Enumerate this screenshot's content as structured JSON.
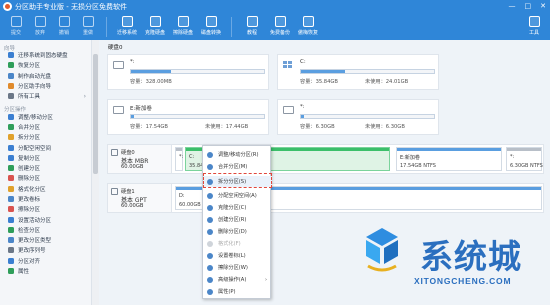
{
  "app": {
    "title": "分区助手专业版 - 无损分区免费软件",
    "window_controls": [
      "—",
      "□",
      "✕"
    ]
  },
  "toolbar": {
    "items": [
      {
        "label": "提交",
        "icon": "commit-icon"
      },
      {
        "label": "放弃",
        "icon": "discard-icon"
      },
      {
        "label": "撤销",
        "icon": "undo-icon"
      },
      {
        "label": "重做",
        "icon": "redo-icon"
      },
      {
        "label": "迁移系统",
        "icon": "migrate-icon"
      },
      {
        "label": "克隆硬盘",
        "icon": "clone-icon"
      },
      {
        "label": "擦除硬盘",
        "icon": "wipe-icon"
      },
      {
        "label": "磁盘转换",
        "icon": "convert-icon"
      },
      {
        "label": "教程",
        "icon": "tutorial-icon"
      },
      {
        "label": "免费备份",
        "icon": "backup-icon"
      },
      {
        "label": "傲梅恢复",
        "icon": "recovery-icon"
      },
      {
        "label": "工具",
        "icon": "tools-icon"
      }
    ]
  },
  "sidebar": {
    "section1": "向导",
    "wizard_items": [
      {
        "label": "迁移系统到固态硬盘",
        "color": "#3b7fd1"
      },
      {
        "label": "恢复分区",
        "color": "#2f9e5a"
      },
      {
        "label": "制作启动光盘",
        "color": "#4b86c8"
      },
      {
        "label": "分区助手向导",
        "color": "#e08a2c"
      },
      {
        "label": "所有工具",
        "color": "#6b7787",
        "arrow": "›"
      }
    ],
    "section2": "分区操作",
    "ops_items": [
      {
        "label": "调整/移动分区",
        "color": "#3b7fd1"
      },
      {
        "label": "合并分区",
        "color": "#2f9e5a"
      },
      {
        "label": "拆分分区",
        "color": "#e0a12c"
      },
      {
        "label": "分配空闲空间",
        "color": "#3b7fd1"
      },
      {
        "label": "复制分区",
        "color": "#3b7fd1"
      },
      {
        "label": "创建分区",
        "color": "#2f9e5a"
      },
      {
        "label": "删除分区",
        "color": "#d9534f"
      },
      {
        "label": "格式化分区",
        "color": "#e0a12c"
      },
      {
        "label": "更改卷标",
        "color": "#4b86c8"
      },
      {
        "label": "擦除分区",
        "color": "#d9534f"
      },
      {
        "label": "设置活动分区",
        "color": "#3b7fd1"
      },
      {
        "label": "检查分区",
        "color": "#2f9e5a"
      },
      {
        "label": "更改分区类型",
        "color": "#4b86c8"
      },
      {
        "label": "更改序列号",
        "color": "#6b7787"
      },
      {
        "label": "分区对齐",
        "color": "#3b7fd1"
      },
      {
        "label": "属性",
        "color": "#2f9e5a"
      }
    ]
  },
  "disk0_title": "硬盘0",
  "disk1_title": "硬盘1",
  "cards": [
    {
      "name": "*:",
      "capacity": "容量：328.00MB",
      "used": "",
      "fill_pct": 30
    },
    {
      "name": "C:",
      "capacity": "容量：35.84GB",
      "used": "未使用：24.01GB",
      "fill_pct": 33
    },
    {
      "name": "E:新加卷",
      "capacity": "容量：17.54GB",
      "used": "未使用：17.44GB",
      "fill_pct": 2
    },
    {
      "name": "*:",
      "capacity": "容量：6.30GB",
      "used": "未使用：6.30GB",
      "fill_pct": 2
    }
  ],
  "diskmap": {
    "disk0": {
      "name": "硬盘0",
      "type": "基本 MBR",
      "size": "60.00GB",
      "partitions": [
        {
          "label": "*:",
          "size": "3...",
          "color": "grey"
        },
        {
          "label": "C:",
          "size": "35.84GB NTFS",
          "color": "green"
        },
        {
          "label": "E:新加卷",
          "size": "17.54GB NTFS",
          "color": "blue"
        },
        {
          "label": "*:",
          "size": "6.30GB NTFS",
          "color": "grey"
        }
      ]
    },
    "disk1": {
      "name": "硬盘1",
      "type": "基本 GPT",
      "size": "60.00GB",
      "partitions": [
        {
          "label": "D:",
          "size": "60.00GB NTFS",
          "color": "blue"
        }
      ]
    }
  },
  "context_menu": {
    "items": [
      {
        "label": "调整/移动分区(R)",
        "disabled": false
      },
      {
        "label": "合并分区(M)",
        "disabled": false
      },
      {
        "label": "拆分分区(S)",
        "disabled": false,
        "highlighted": true
      },
      {
        "label": "分配空闲空间(A)",
        "disabled": false
      },
      {
        "label": "克隆分区(C)",
        "disabled": false
      },
      {
        "label": "创建分区(R)",
        "disabled": false
      },
      {
        "label": "删除分区(D)",
        "disabled": false
      },
      {
        "label": "格式化(F)",
        "disabled": true
      },
      {
        "label": "设置卷标(L)",
        "disabled": false
      },
      {
        "label": "擦除分区(W)",
        "disabled": false
      },
      {
        "label": "高级操作(A)",
        "disabled": false,
        "submenu": "›"
      },
      {
        "label": "属性(P)",
        "disabled": false
      }
    ]
  },
  "watermark": {
    "big": "系统城",
    "small": "XITONGCHENG.COM"
  }
}
